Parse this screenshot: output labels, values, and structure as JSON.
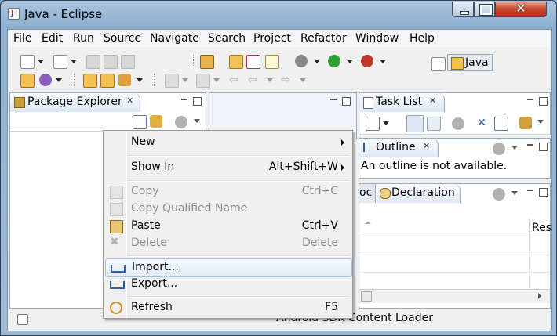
{
  "window": {
    "title": "Java - Eclipse",
    "icon": "eclipse-java-icon"
  },
  "menubar": [
    "File",
    "Edit",
    "Run",
    "Source",
    "Navigate",
    "Search",
    "Project",
    "Refactor",
    "Window",
    "Help"
  ],
  "perspective": {
    "label": "Java"
  },
  "package_explorer": {
    "tab_label": "Package Explorer"
  },
  "task_list": {
    "tab_label": "Task List"
  },
  "outline": {
    "tab_label": "Outline",
    "message": "An outline is not available."
  },
  "declaration": {
    "tab_partial": "oc",
    "tab_label": "Declaration",
    "col_res": "Res"
  },
  "status": {
    "text": "Android SDK Content Loader"
  },
  "context_menu": {
    "new": "New",
    "show_in": "Show In",
    "show_in_key": "Alt+Shift+W",
    "copy": "Copy",
    "copy_key": "Ctrl+C",
    "copy_qualified": "Copy Qualified Name",
    "paste": "Paste",
    "paste_key": "Ctrl+V",
    "delete": "Delete",
    "delete_key": "Delete",
    "import": "Import...",
    "export": "Export...",
    "refresh": "Refresh",
    "refresh_key": "F5"
  }
}
